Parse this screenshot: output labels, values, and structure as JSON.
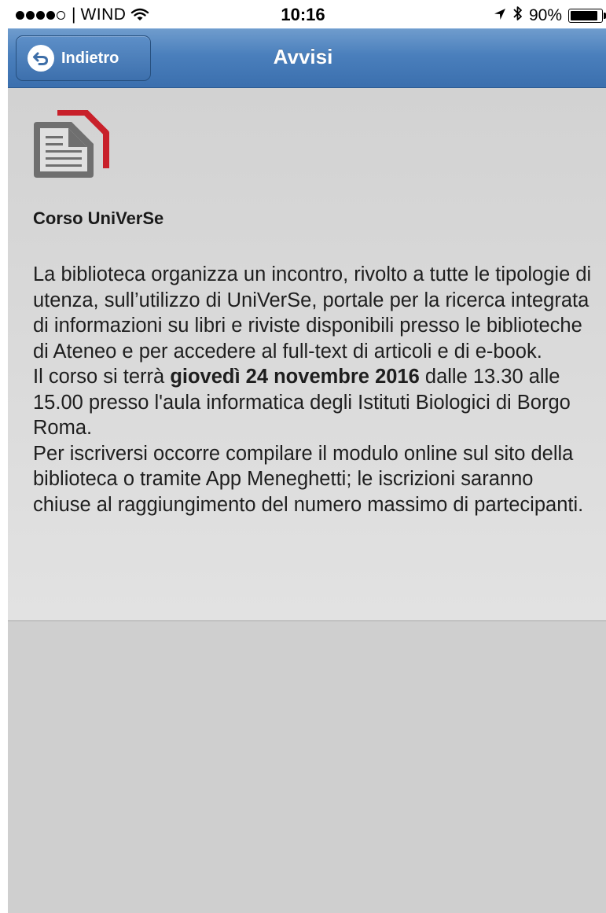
{
  "status_bar": {
    "signal_filled": 4,
    "signal_total": 5,
    "carrier": "WIND",
    "time": "10:16",
    "battery": "90%",
    "battery_level": 0.9,
    "icons": [
      "wifi-icon",
      "location-arrow-icon",
      "bluetooth-icon",
      "battery-icon"
    ]
  },
  "nav": {
    "back_label": "Indietro",
    "back_icon": "back-arrow-icon",
    "title": "Avvisi",
    "bar_color": "#4a7fbc"
  },
  "notice": {
    "icon": "document-icon",
    "icon_accent_color": "#c8202a",
    "title": "Corso UniVerSe",
    "paragraph_1": "La biblioteca organizza un incontro, rivolto a tutte le tipologie di utenza, sull’utilizzo di UniVerSe, portale per la ricerca integrata di informazioni su libri e riviste disponibili presso le biblioteche di Ateneo e per accedere al full-text di articoli e di e-book.",
    "paragraph_2_before": "Il corso si terrà",
    "paragraph_2_bold": "giovedì 24 novembre 2016",
    "paragraph_2_after": "dalle 13.30 alle 15.00 presso l'aula informatica degli Istituti Biologici di Borgo Roma.",
    "paragraph_3": "Per iscriversi occorre compilare il modulo online sul sito della biblioteca o tramite App Meneghetti; le iscrizioni saranno chiuse al raggiungimento del numero massimo di partecipanti."
  }
}
